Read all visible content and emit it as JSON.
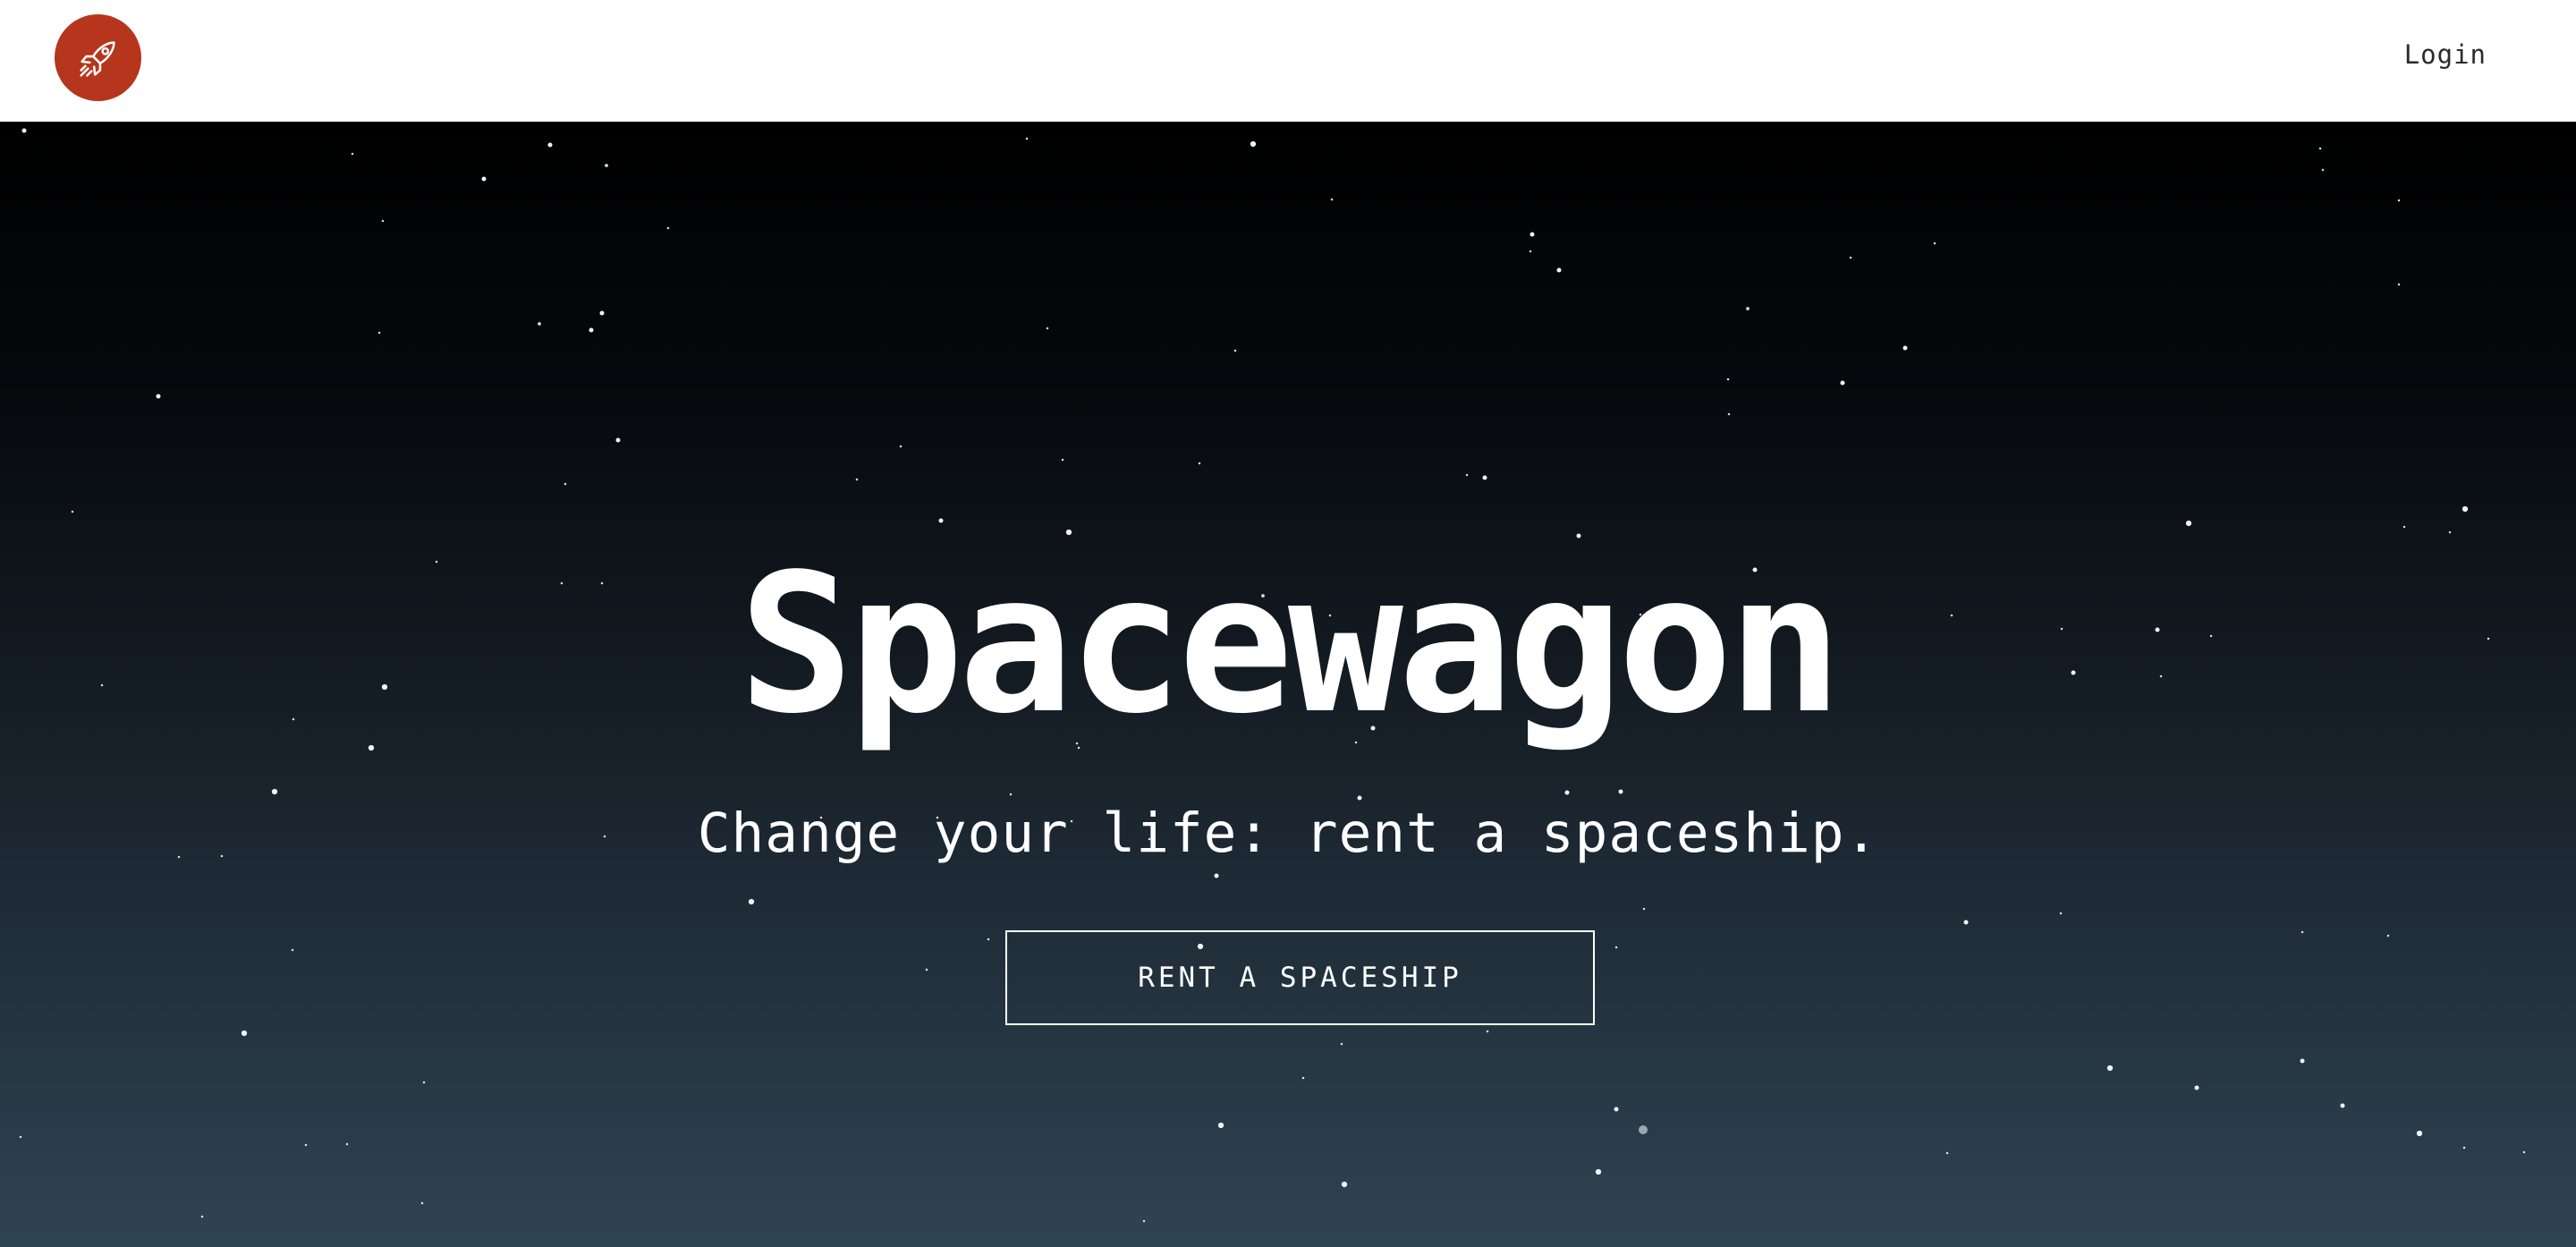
{
  "header": {
    "logo_icon": "rocket-icon",
    "logo_color": "#b5361c",
    "login_label": "Login"
  },
  "hero": {
    "title": "Spacewagon",
    "subtitle": "Change your life: rent a spaceship.",
    "cta_label": "RENT A SPACESHIP",
    "gradient_top": "#000000",
    "gradient_bottom": "#2f4453"
  }
}
